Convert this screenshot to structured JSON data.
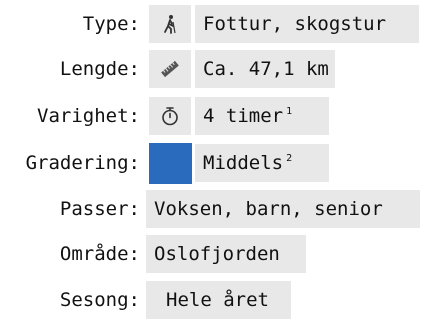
{
  "rows": {
    "type": {
      "label": "Type:",
      "value": "Fottur, skogstur",
      "icon": "hiker-icon"
    },
    "length": {
      "label": "Lengde:",
      "value": "Ca. 47,1 km",
      "icon": "ruler-icon"
    },
    "duration": {
      "label": "Varighet:",
      "value": "4 timer",
      "note": "1",
      "icon": "stopwatch-icon"
    },
    "grade": {
      "label": "Gradering:",
      "value": "Middels",
      "note": "2",
      "color": "#2a6bbd"
    },
    "suits": {
      "label": "Passer:",
      "value": "Voksen, barn, senior"
    },
    "area": {
      "label": "Område:",
      "value": "Oslofjorden"
    },
    "season": {
      "label": "Sesong:",
      "value": "Hele året"
    }
  }
}
